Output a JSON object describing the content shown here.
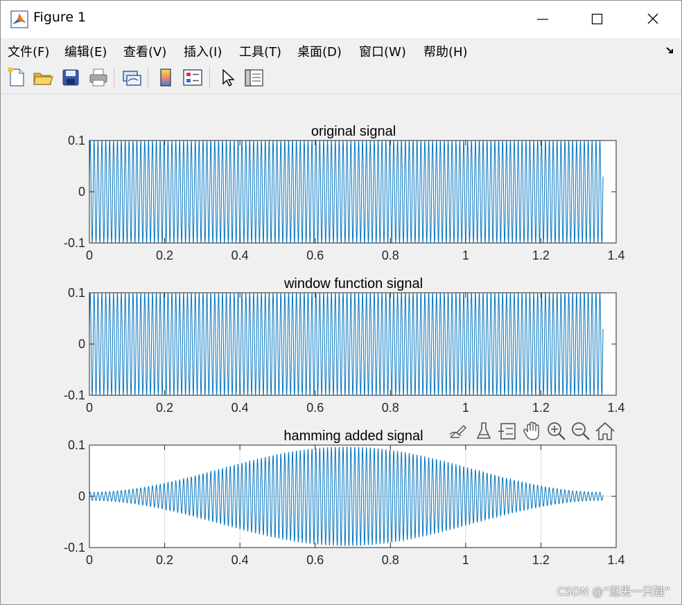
{
  "window": {
    "title": "Figure 1",
    "controls": [
      "minimize",
      "maximize",
      "close"
    ]
  },
  "menubar": {
    "items": [
      {
        "label": "文件(F)"
      },
      {
        "label": "编辑(E)"
      },
      {
        "label": "查看(V)"
      },
      {
        "label": "插入(I)"
      },
      {
        "label": "工具(T)"
      },
      {
        "label": "桌面(D)"
      },
      {
        "label": "窗口(W)"
      },
      {
        "label": "帮助(H)"
      }
    ]
  },
  "toolbar": {
    "buttons": [
      "new-figure-icon",
      "open-file-icon",
      "save-icon",
      "print-icon",
      "link-plot-icon",
      "colorbar-icon",
      "legend-icon",
      "pointer-icon",
      "property-inspector-icon"
    ]
  },
  "axes_toolbar": {
    "buttons": [
      "export-icon",
      "brush-icon",
      "data-tips-icon",
      "pan-icon",
      "zoom-in-icon",
      "zoom-out-icon",
      "home-icon"
    ]
  },
  "colors": {
    "line": "#0072bd",
    "grid": "#dcdcdc",
    "axes_bg": "#ffffff",
    "figure_bg": "#f0f0f0"
  },
  "chart_data": [
    {
      "type": "line",
      "title": "original signal",
      "xlabel": "",
      "ylabel": "",
      "xlim": [
        0,
        1.4
      ],
      "ylim": [
        -0.1,
        0.1
      ],
      "xticks": [
        "0",
        "0.2",
        "0.4",
        "0.6",
        "0.8",
        "1",
        "1.2",
        "1.4"
      ],
      "yticks": [
        "0.1",
        "0",
        "-0.1"
      ],
      "grid": false,
      "series": [
        {
          "amplitude": 0.1,
          "x_end": 1.365,
          "cycles": 132,
          "envelope": "none"
        }
      ]
    },
    {
      "type": "line",
      "title": "window function signal",
      "xlabel": "",
      "ylabel": "",
      "xlim": [
        0,
        1.4
      ],
      "ylim": [
        -0.1,
        0.1
      ],
      "xticks": [
        "0",
        "0.2",
        "0.4",
        "0.6",
        "0.8",
        "1",
        "1.2",
        "1.4"
      ],
      "yticks": [
        "0.1",
        "0",
        "-0.1"
      ],
      "grid": false,
      "series": [
        {
          "amplitude": 0.1,
          "x_end": 1.365,
          "cycles": 132,
          "envelope": "none"
        }
      ]
    },
    {
      "type": "line",
      "title": "hamming added signal",
      "xlabel": "",
      "ylabel": "",
      "xlim": [
        0,
        1.4
      ],
      "ylim": [
        -0.1,
        0.1
      ],
      "xticks": [
        "0",
        "0.2",
        "0.4",
        "0.6",
        "0.8",
        "1",
        "1.2",
        "1.4"
      ],
      "yticks": [
        "0.1",
        "0",
        "-0.1"
      ],
      "grid": true,
      "series": [
        {
          "amplitude": 0.1,
          "x_end": 1.365,
          "cycles": 132,
          "envelope": "hamming"
        }
      ]
    }
  ],
  "watermark": "CSDN @“逛丢一只鞋”"
}
